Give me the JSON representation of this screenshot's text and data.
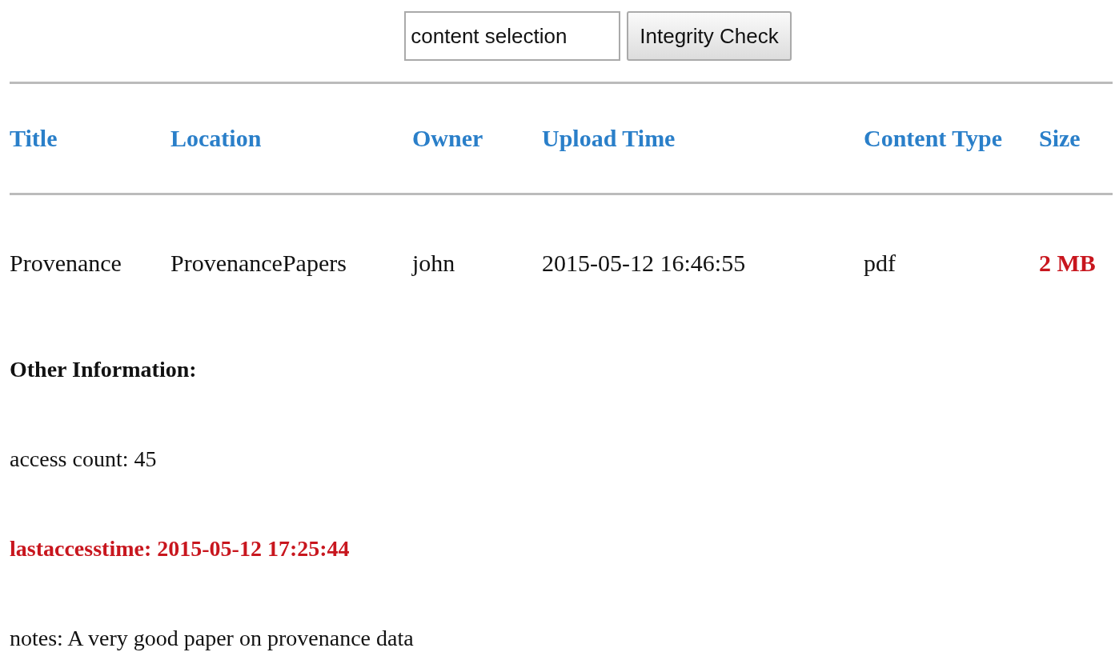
{
  "search": {
    "value": "content selection"
  },
  "button": {
    "label": "Integrity Check"
  },
  "table": {
    "columns": [
      "Title",
      "Location",
      "Owner",
      "Upload Time",
      "Content Type",
      "Size"
    ],
    "rows": [
      {
        "cells": [
          {
            "text": "Provenance",
            "emphasis": false
          },
          {
            "text": "ProvenancePapers",
            "emphasis": false
          },
          {
            "text": "john",
            "emphasis": false
          },
          {
            "text": "2015-05-12 16:46:55",
            "emphasis": false
          },
          {
            "text": "pdf",
            "emphasis": false
          },
          {
            "text": "2 MB",
            "emphasis": true
          }
        ]
      }
    ]
  },
  "other_information": {
    "heading": "Other Information:",
    "lines": [
      {
        "text": "access count: 45",
        "emphasis": false
      },
      {
        "text": "lastaccesstime: 2015-05-12 17:25:44",
        "emphasis": true
      },
      {
        "text": "notes: A very good paper on provenance data",
        "emphasis": false
      }
    ]
  }
}
